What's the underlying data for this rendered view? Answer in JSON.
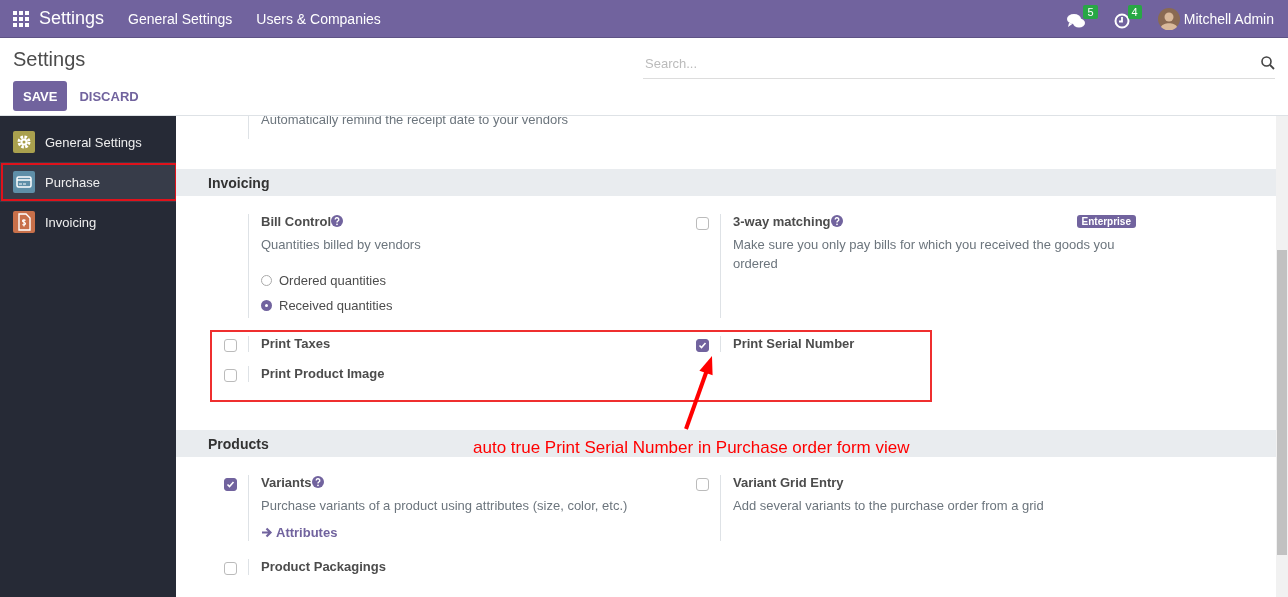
{
  "navbar": {
    "app_title": "Settings",
    "menu": [
      {
        "label": "General Settings"
      },
      {
        "label": "Users & Companies"
      }
    ],
    "systray": [
      {
        "kind": "messages",
        "badge": "5"
      },
      {
        "kind": "activities",
        "badge": "4"
      }
    ],
    "user": {
      "name": "Mitchell Admin"
    }
  },
  "control_panel": {
    "title": "Settings",
    "search": {
      "placeholder": "Search..."
    },
    "buttons": [
      {
        "label": "SAVE",
        "kind": "primary"
      },
      {
        "label": "DISCARD",
        "kind": "link"
      }
    ]
  },
  "sidebar": {
    "items": [
      {
        "label": "General Settings",
        "selected": false,
        "outlined": false,
        "color": "#a9a04e"
      },
      {
        "label": "Purchase",
        "selected": true,
        "outlined": true,
        "color": "#5f8fa8"
      },
      {
        "label": "Invoicing",
        "selected": false,
        "outlined": false,
        "color": "#c8704a"
      }
    ]
  },
  "cut_setting": {
    "description": "Automatically remind the receipt date to your vendors"
  },
  "sections": [
    {
      "title": "Invoicing",
      "blocks": [
        {
          "annotated": false,
          "rows": [
            {
              "left": {
                "kind": "plain",
                "label": "Bill Control",
                "help": true,
                "description": "Quantities billed by vendors",
                "options": [
                  {
                    "label": "Ordered quantities",
                    "selected": false
                  },
                  {
                    "label": "Received quantities",
                    "selected": true
                  }
                ]
              },
              "right": {
                "kind": "checkbox",
                "checked": false,
                "label": "3-way matching",
                "help": true,
                "badge": "Enterprise",
                "description": "Make sure you only pay bills for which you received the goods you ordered"
              }
            }
          ]
        },
        {
          "annotated": true,
          "callout": {
            "text": "auto true Print Serial Number in Purchase order form view"
          },
          "rows": [
            {
              "left": {
                "kind": "checkbox",
                "checked": false,
                "label": "Print Taxes"
              },
              "right": {
                "kind": "checkbox",
                "checked": true,
                "label": "Print Serial Number"
              }
            },
            {
              "left": {
                "kind": "checkbox",
                "checked": false,
                "label": "Print Product Image"
              }
            }
          ]
        }
      ]
    },
    {
      "title": "Products",
      "blocks": [
        {
          "annotated": false,
          "rows": [
            {
              "left": {
                "kind": "checkbox",
                "checked": true,
                "label": "Variants",
                "help": true,
                "description": "Purchase variants of a product using attributes (size, color, etc.)",
                "link": "Attributes"
              },
              "right": {
                "kind": "checkbox",
                "checked": false,
                "label": "Variant Grid Entry",
                "description": "Add several variants to the purchase order from a grid"
              }
            },
            {
              "left": {
                "kind": "checkbox",
                "checked": false,
                "label": "Product Packagings"
              }
            }
          ]
        }
      ]
    }
  ]
}
